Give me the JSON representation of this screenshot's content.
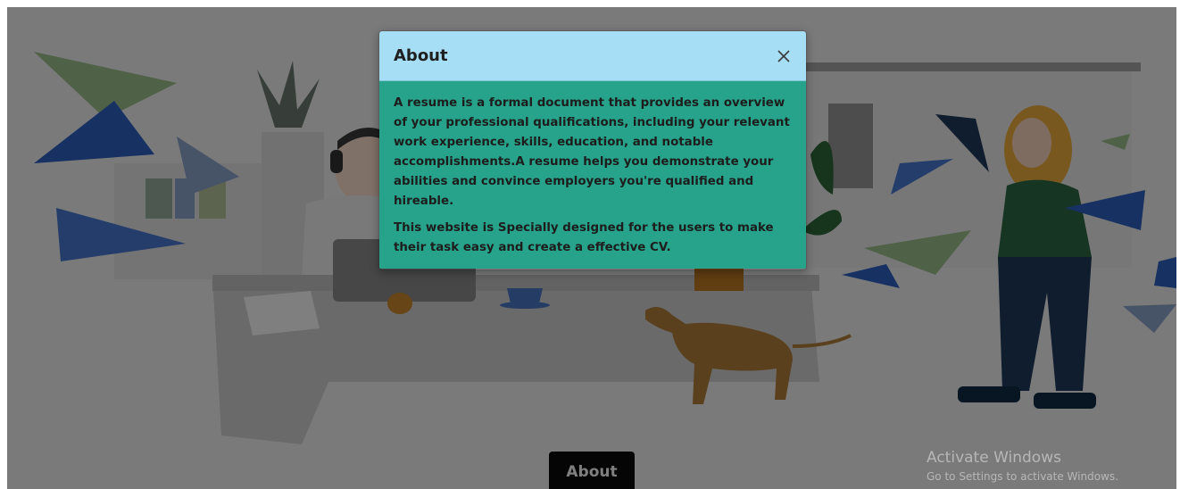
{
  "modal": {
    "title": "About",
    "close_icon": "close-icon",
    "paragraphs": [
      "A resume is a formal document that provides an overview of your professional qualifications, including your relevant work experience, skills, education, and notable accomplishments.A resume helps you demonstrate your abilities and convince employers you're qualified and hireable.",
      "This website is Specially designed for the users to make their task easy and create a effective CV."
    ]
  },
  "page": {
    "about_button_label": "About"
  },
  "watermark": {
    "title": "Activate Windows",
    "subtitle": "Go to Settings to activate Windows."
  },
  "colors": {
    "modal_header": "#a6def6",
    "modal_body": "#26a38a",
    "button": "#0a0a0a",
    "overlay": "rgba(0,0,0,0.5)"
  }
}
